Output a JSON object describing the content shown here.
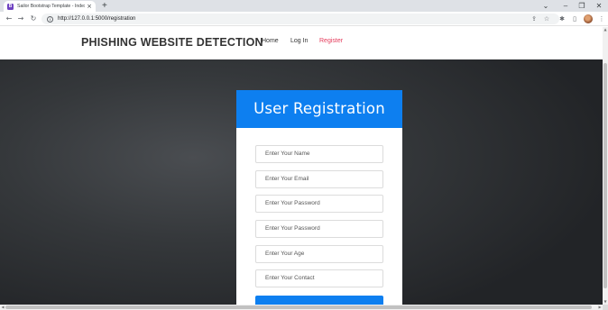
{
  "browser": {
    "tab_title": "Sailor Bootstrap Template - Index",
    "tab_close": "×",
    "new_tab": "+",
    "url": "http://127.0.0.1:5000/registration",
    "window_controls": {
      "chevron": "⌄",
      "minimize": "–",
      "restore": "❐",
      "close": "✕"
    }
  },
  "site": {
    "brand": "PHISHING WEBSITE DETECTION",
    "nav": [
      {
        "label": "Home"
      },
      {
        "label": "Log In"
      },
      {
        "label": "Register"
      }
    ],
    "active_color": "#e43c5c"
  },
  "form": {
    "title": "User Registration",
    "fields": [
      {
        "placeholder": "Enter Your Name"
      },
      {
        "placeholder": "Enter Your Email"
      },
      {
        "placeholder": "Enter Your Password"
      },
      {
        "placeholder": "Enter Your Password"
      },
      {
        "placeholder": "Enter Your Age"
      },
      {
        "placeholder": "Enter Your Contact"
      }
    ],
    "accent_color": "#0d7ff0"
  }
}
